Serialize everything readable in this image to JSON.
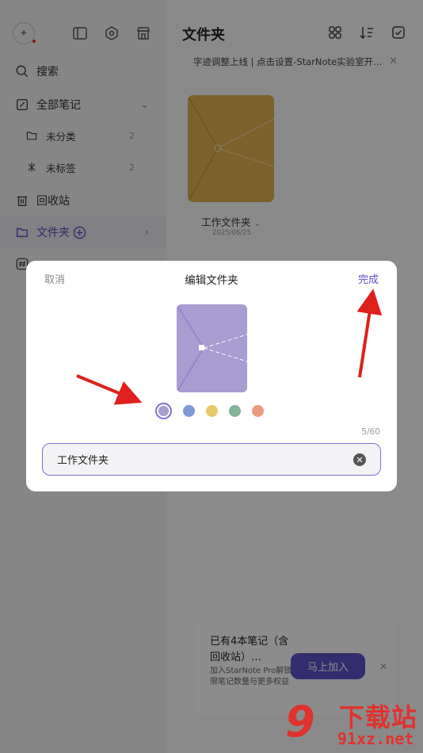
{
  "sidebar": {
    "search": "搜索",
    "all_notes": "全部笔记",
    "uncategorized": "未分类",
    "uncategorized_count": "2",
    "untagged": "未标签",
    "untagged_count": "2",
    "trash": "回收站",
    "folders": "文件夹"
  },
  "main": {
    "title": "文件夹",
    "banner": "字迹调整上线 | 点击设置-StarNote实验室开…",
    "folder": {
      "name": "工作文件夹",
      "date": "2025/06/25",
      "color": "#e1b24f"
    }
  },
  "promo": {
    "line1": "已有4本笔记（含回收站）…",
    "line2": "加入StarNote Pro解锁无限笔记数量与更多权益",
    "button": "马上加入"
  },
  "dialog": {
    "cancel": "取消",
    "title": "编辑文件夹",
    "done": "完成",
    "preview_color": "#a89cd0",
    "colors": [
      "#a89cd0",
      "#7f9bd6",
      "#e8c86a",
      "#82b59a",
      "#ec9a7e"
    ],
    "selected_color": 0,
    "counter": "5/60",
    "input_value": "工作文件夹"
  },
  "watermark": {
    "mark": "9",
    "line1": "下载站",
    "line2": "91xz.net"
  }
}
